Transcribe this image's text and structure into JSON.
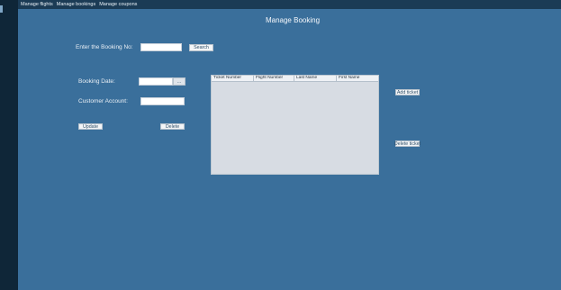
{
  "menu": {
    "items": [
      "Manage flights",
      "Manage bookings",
      "Manage coupons"
    ]
  },
  "page": {
    "title": "Manage Booking"
  },
  "search": {
    "label": "Enter the Booking No:",
    "value": "",
    "button_label": "Search"
  },
  "form": {
    "booking_date_label": "Booking Date:",
    "booking_date_value": "",
    "date_picker_button": "...",
    "customer_account_label": "Customer Account:",
    "customer_account_value": "",
    "update_label": "Update",
    "delete_label": "Delete"
  },
  "tickets_table": {
    "columns": [
      "Ticket Number",
      "Flight Number",
      "Last Name",
      "First Name"
    ],
    "rows": []
  },
  "ticket_actions": {
    "add_label": "Add ticket",
    "delete_label": "Delete ticket"
  },
  "colors": {
    "background": "#3a6f9b",
    "left_strip": "#0f2638",
    "menubar": "#1b3b55"
  }
}
